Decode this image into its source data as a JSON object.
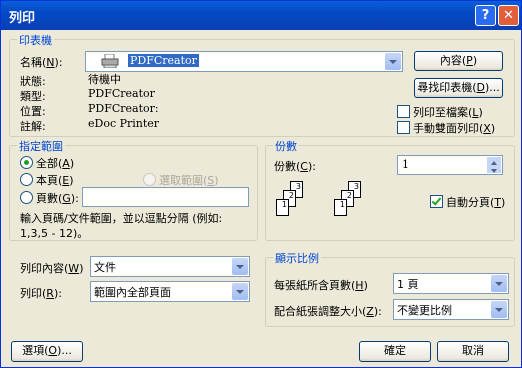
{
  "window": {
    "title": "列印",
    "help": "?",
    "close": "✕"
  },
  "printer": {
    "legend": "印表機",
    "name_label": "名稱(",
    "name_key": "N",
    "name_after": "):",
    "name_value": "PDFCreator",
    "status_label": "狀態:",
    "status_value": "待機中",
    "type_label": "類型:",
    "type_value": "PDFCreator",
    "location_label": "位置:",
    "location_value": "PDFCreator:",
    "comment_label": "註解:",
    "comment_value": "eDoc Printer",
    "properties_button": "內容(",
    "properties_key": "P",
    "properties_after": ")",
    "find_button": "尋找印表機(",
    "find_key": "D",
    "find_after": ")...",
    "print_to_file": "列印至檔案(",
    "print_to_file_key": "L",
    "print_to_file_after": ")",
    "manual_duplex": "手動雙面列印(",
    "manual_duplex_key": "X",
    "manual_duplex_after": ")"
  },
  "range": {
    "legend": "指定範圍",
    "all": "全部(",
    "all_key": "A",
    "all_after": ")",
    "current": "本頁(",
    "current_key": "E",
    "current_after": ")",
    "selection": "選取範圍(",
    "selection_key": "S",
    "selection_after": ")",
    "pages": "頁數(",
    "pages_key": "G",
    "pages_after": "):",
    "pages_value": "",
    "hint_line1": "輸入頁碼/文件範圍，並以逗點分隔 (例如:",
    "hint_line2": "1,3,5 - 12)。"
  },
  "copies": {
    "legend": "份數",
    "label": "份數(",
    "label_key": "C",
    "label_after": "):",
    "value": "1",
    "collate": "自動分頁(",
    "collate_key": "T",
    "collate_after": ")",
    "collate_checked": true
  },
  "print_what": {
    "label": "列印內容(",
    "label_key": "W",
    "label_after": ")",
    "value": "文件"
  },
  "print": {
    "label": "列印(",
    "label_key": "R",
    "label_after": "):",
    "value": "範圍內全部頁面"
  },
  "zoom": {
    "legend": "顯示比例",
    "pages_per_sheet_label": "每張紙所含頁數(",
    "pages_per_sheet_key": "H",
    "pages_per_sheet_after": ")",
    "pages_per_sheet_value": "1 頁",
    "scale_label": "配合紙張調整大小(",
    "scale_key": "Z",
    "scale_after": "):",
    "scale_value": "不變更比例"
  },
  "footer": {
    "options": "選項(",
    "options_key": "O",
    "options_after": ")...",
    "ok": "確定",
    "cancel": "取消"
  }
}
